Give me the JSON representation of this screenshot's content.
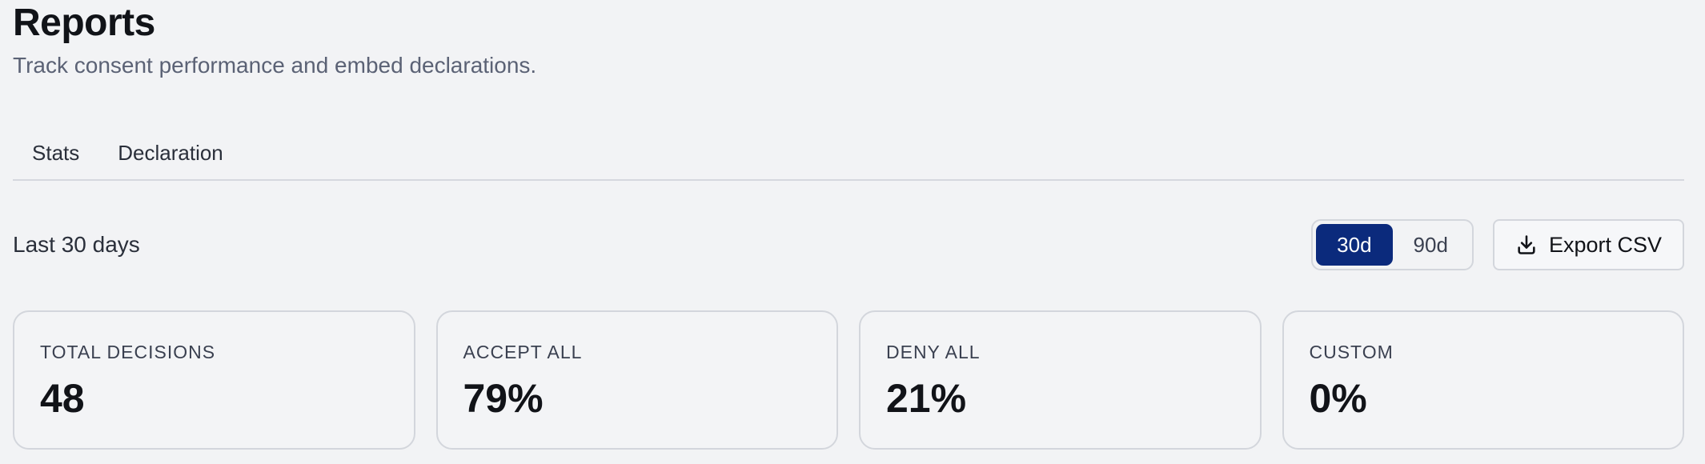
{
  "header": {
    "title": "Reports",
    "subtitle": "Track consent performance and embed declarations."
  },
  "tabs": [
    {
      "label": "Stats"
    },
    {
      "label": "Declaration"
    }
  ],
  "toolbar": {
    "range_label": "Last 30 days",
    "range_options": [
      {
        "label": "30d",
        "selected": true
      },
      {
        "label": "90d",
        "selected": false
      }
    ],
    "export_label": "Export CSV",
    "export_icon": "download-icon",
    "accent_color": "#0b2a7c"
  },
  "stats": [
    {
      "label": "TOTAL DECISIONS",
      "value": "48"
    },
    {
      "label": "ACCEPT ALL",
      "value": "79%"
    },
    {
      "label": "DENY ALL",
      "value": "21%"
    },
    {
      "label": "CUSTOM",
      "value": "0%"
    }
  ]
}
